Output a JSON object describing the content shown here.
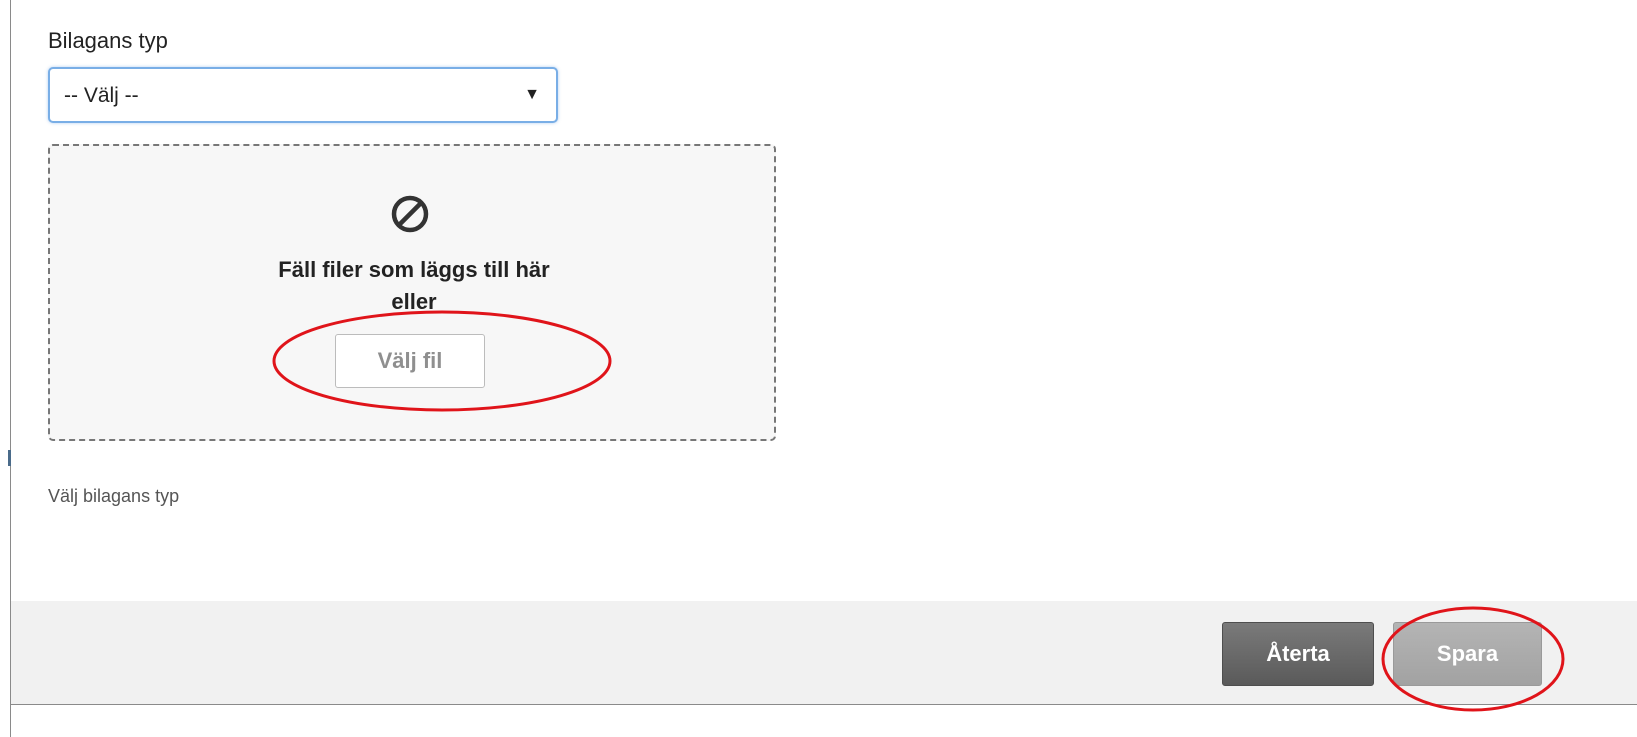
{
  "form": {
    "attachment_type_label": "Bilagans typ",
    "attachment_type_selected": "-- Välj --",
    "help_text": "Välj bilagans typ"
  },
  "dropzone": {
    "icon": "prohibit-icon",
    "line1": "Fäll filer som läggs till här",
    "line2": "eller",
    "choose_file_label": "Välj fil"
  },
  "footer": {
    "cancel_label": "Återta",
    "save_label": "Spara"
  },
  "colors": {
    "select_focus_border": "#79aee6",
    "annotation_red": "#e0141a",
    "cancel_button": "#6a6a6a",
    "save_button_disabled": "#aaaaaa"
  }
}
